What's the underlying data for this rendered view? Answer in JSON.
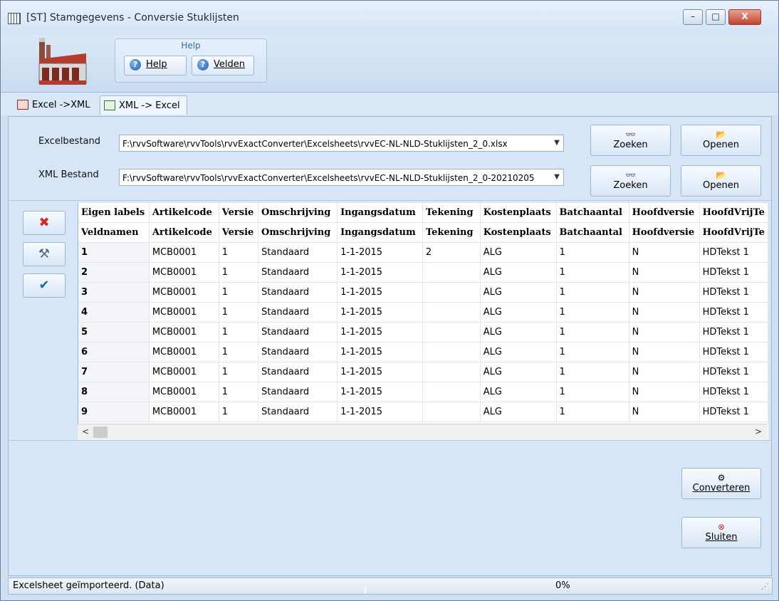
{
  "window": {
    "title": "[ST]  Stamgegevens - Conversie Stuklijsten",
    "controls": {
      "minimize": "–",
      "maximize": "□",
      "close": "X"
    }
  },
  "ribbon": {
    "group_title": "Help",
    "help_button": "Help",
    "velden_button": "Velden",
    "help_icon": "question-icon"
  },
  "tabs": [
    {
      "label": "Excel ->XML",
      "active": false
    },
    {
      "label": "XML -> Excel",
      "active": true
    }
  ],
  "files": {
    "excel_label": "Excelbestand",
    "excel_value": "F:\\rvvSoftware\\rvvTools\\rvvExactConverter\\Excelsheets\\rvvEC-NL-NLD-Stuklijsten_2_0.xlsx",
    "xml_label": "XML Bestand",
    "xml_value": "F:\\rvvSoftware\\rvvTools\\rvvExactConverter\\Excelsheets\\rvvEC-NL-NLD-Stuklijsten_2_0-20210205",
    "zoeken": "Zoeken",
    "openen": "Openen"
  },
  "side_buttons": [
    {
      "name": "delete-icon",
      "glyph": "✖",
      "color": "#d42a1e"
    },
    {
      "name": "hammer-icon",
      "glyph": "⚒",
      "color": "#5a6b7c"
    },
    {
      "name": "check-icon",
      "glyph": "✔",
      "color": "#2a64b8"
    }
  ],
  "grid": {
    "labels_row": [
      "Eigen labels",
      "Artikelcode",
      "Versie",
      "Omschrijving",
      "Ingangsdatum",
      "Tekening",
      "Kostenplaats",
      "Batchaantal",
      "Hoofdversie",
      "HoofdVrijTe"
    ],
    "fields_row": [
      "Veldnamen",
      "Artikelcode",
      "Versie",
      "Omschrijving",
      "Ingangsdatum",
      "Tekening",
      "Kostenplaats",
      "Batchaantal",
      "Hoofdversie",
      "HoofdVrijTe"
    ],
    "rows": [
      [
        "1",
        "MCB0001",
        "1",
        "Standaard",
        "1-1-2015",
        "2",
        "ALG",
        "1",
        "N",
        "HDTekst 1"
      ],
      [
        "2",
        "MCB0001",
        "1",
        "Standaard",
        "1-1-2015",
        "",
        "ALG",
        "1",
        "N",
        "HDTekst 1"
      ],
      [
        "3",
        "MCB0001",
        "1",
        "Standaard",
        "1-1-2015",
        "",
        "ALG",
        "1",
        "N",
        "HDTekst 1"
      ],
      [
        "4",
        "MCB0001",
        "1",
        "Standaard",
        "1-1-2015",
        "",
        "ALG",
        "1",
        "N",
        "HDTekst 1"
      ],
      [
        "5",
        "MCB0001",
        "1",
        "Standaard",
        "1-1-2015",
        "",
        "ALG",
        "1",
        "N",
        "HDTekst 1"
      ],
      [
        "6",
        "MCB0001",
        "1",
        "Standaard",
        "1-1-2015",
        "",
        "ALG",
        "1",
        "N",
        "HDTekst 1"
      ],
      [
        "7",
        "MCB0001",
        "1",
        "Standaard",
        "1-1-2015",
        "",
        "ALG",
        "1",
        "N",
        "HDTekst 1"
      ],
      [
        "8",
        "MCB0001",
        "1",
        "Standaard",
        "1-1-2015",
        "",
        "ALG",
        "1",
        "N",
        "HDTekst 1"
      ],
      [
        "9",
        "MCB0001",
        "1",
        "Standaard",
        "1-1-2015",
        "",
        "ALG",
        "1",
        "N",
        "HDTekst 1"
      ]
    ]
  },
  "actions": {
    "converteren": "Converteren",
    "sluiten": "Sluiten"
  },
  "status": {
    "text": "Excelsheet geïmporteerd. (Data)",
    "progress": "0%"
  }
}
